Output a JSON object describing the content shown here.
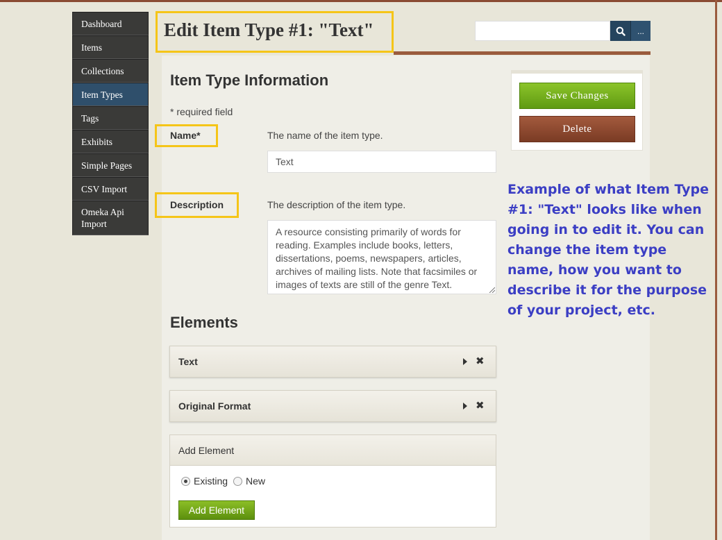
{
  "sidebar": {
    "items": [
      {
        "label": "Dashboard"
      },
      {
        "label": "Items"
      },
      {
        "label": "Collections"
      },
      {
        "label": "Item Types"
      },
      {
        "label": "Tags"
      },
      {
        "label": "Exhibits"
      },
      {
        "label": "Simple Pages"
      },
      {
        "label": "CSV Import"
      },
      {
        "label": "Omeka Api Import"
      }
    ],
    "active": "Item Types"
  },
  "header": {
    "title": "Edit Item Type #1: \"Text\"",
    "search": {
      "value": "",
      "more_label": "..."
    }
  },
  "form": {
    "section_title": "Item Type Information",
    "required_note": "* required field",
    "name": {
      "label": "Name*",
      "help": "The name of the item type.",
      "value": "Text"
    },
    "description": {
      "label": "Description",
      "help": "The description of the item type.",
      "value": "A resource consisting primarily of words for reading. Examples include books, letters, dissertations, poems, newspapers, articles, archives of mailing lists. Note that facsimiles or images of texts are still of the genre Text."
    }
  },
  "elements": {
    "section_title": "Elements",
    "items": [
      {
        "name": "Text"
      },
      {
        "name": "Original Format"
      }
    ],
    "add": {
      "header": "Add Element",
      "options": [
        {
          "label": "Existing",
          "checked": true
        },
        {
          "label": "New",
          "checked": false
        }
      ],
      "button_label": "Add Element"
    }
  },
  "actions": {
    "save_label": "Save Changes",
    "delete_label": "Delete"
  },
  "annotation": "Example of what Item Type #1: \"Text\" looks like when going in to edit it. You can change the item type name, how you want to describe it for the purpose of your project, etc.",
  "colors": {
    "highlight": "#f5c518",
    "annotation": "#3b3ec4",
    "save": "#6fa91a",
    "delete": "#8a4a30",
    "nav_active": "#2f4f6b"
  }
}
